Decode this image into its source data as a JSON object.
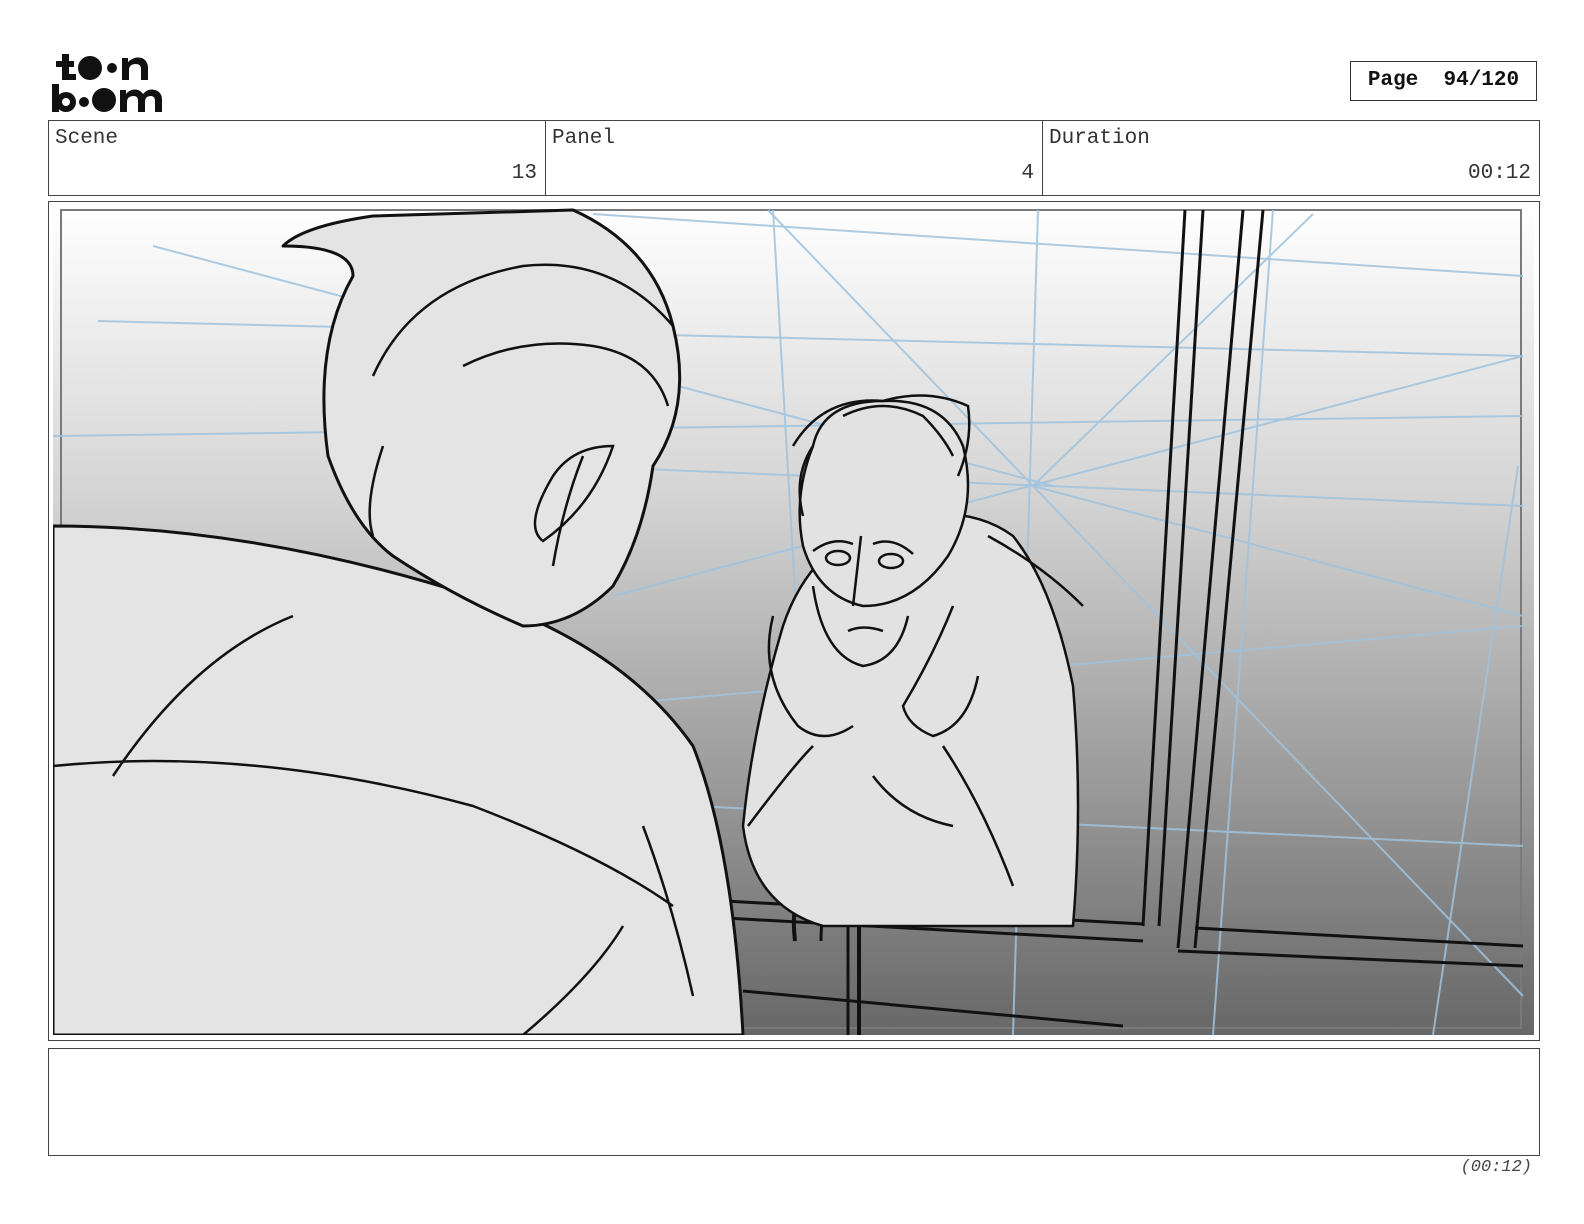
{
  "brand": {
    "logo_top": "to●n",
    "logo_bottom": "b●●m"
  },
  "page": {
    "label": "Page",
    "value": "94/120"
  },
  "header": {
    "scene": {
      "label": "Scene",
      "value": "13"
    },
    "panel": {
      "label": "Panel",
      "value": "4"
    },
    "duration": {
      "label": "Duration",
      "value": "00:12"
    }
  },
  "notes": {
    "text": ""
  },
  "footer": {
    "duration": "(00:12)"
  }
}
